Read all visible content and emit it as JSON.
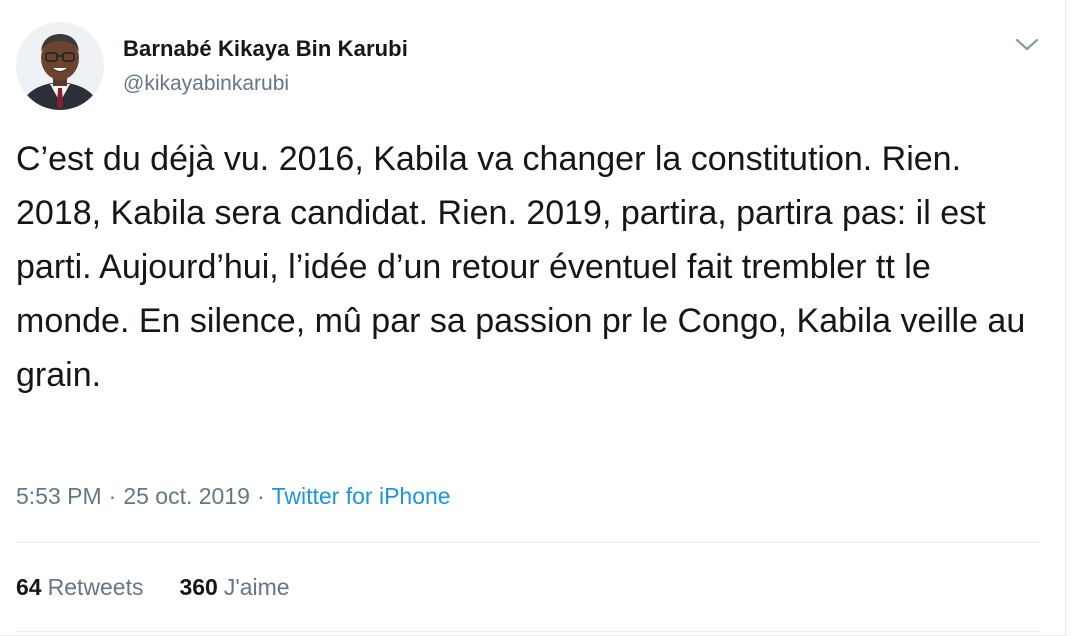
{
  "tweet": {
    "author_name": "Barnabé Kikaya Bin Karubi",
    "handle": "@kikayabinkarubi",
    "text": "C’est du déjà vu. 2016, Kabila va changer la constitution. Rien. 2018, Kabila sera candidat. Rien. 2019, partira, partira pas: il est parti. Aujourd’hui, l’idée d’un retour éventuel fait trembler tt le monde. En silence, mû par sa passion pr le Congo, Kabila veille au grain.",
    "time": "5:53 PM",
    "separator": "·",
    "date": "25 oct. 2019",
    "source": "Twitter for iPhone",
    "retweets_count": "64",
    "retweets_label": "Retweets",
    "likes_count": "360",
    "likes_label": "J'aime"
  },
  "icons": {
    "menu": "chevron-down-icon",
    "avatar": "profile-photo"
  },
  "colors": {
    "text": "#14171a",
    "secondary": "#657786",
    "link": "#1b95e0",
    "divider": "#e6ecf0"
  }
}
